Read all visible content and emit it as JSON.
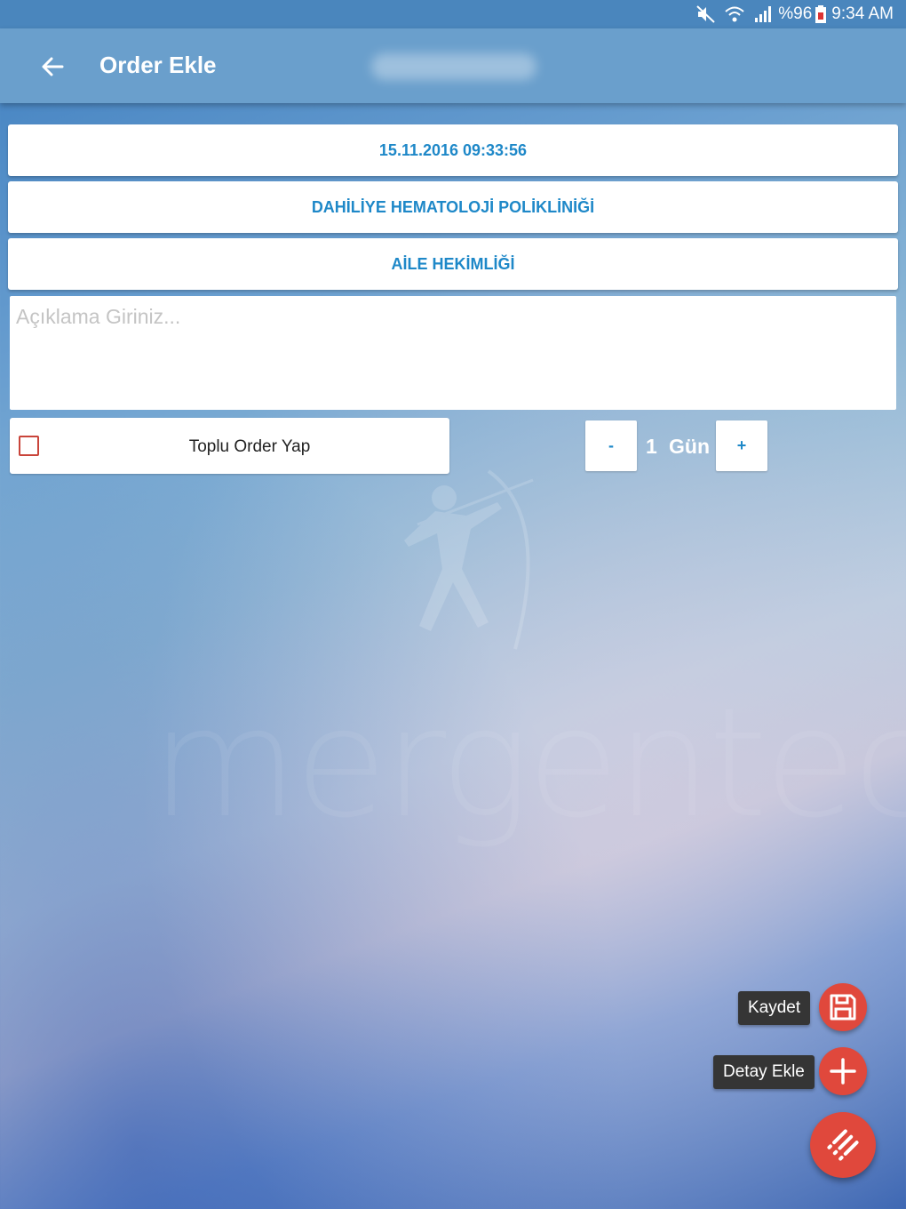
{
  "status_bar": {
    "battery_percent": "%96",
    "time": "9:34 AM",
    "icons": [
      "mute-icon",
      "wifi-icon",
      "signal-icon",
      "battery-icon"
    ]
  },
  "app_bar": {
    "title": "Order Ekle",
    "back_icon": "arrow-left-icon"
  },
  "form": {
    "datetime": "15.11.2016 09:33:56",
    "clinic": "DAHİLİYE HEMATOLOJİ POLİKLİNİĞİ",
    "department": "AİLE HEKİMLİĞİ",
    "note_placeholder": "Açıklama Giriniz...",
    "bulk_order_label": "Toplu Order Yap",
    "bulk_order_checked": false,
    "decrement_label": "-",
    "increment_label": "+",
    "day_count": "1",
    "day_unit": "Gün"
  },
  "fab_menu": {
    "save_label": "Kaydet",
    "add_detail_label": "Detay Ekle",
    "save_icon": "floppy-disk-icon",
    "add_icon": "plus-icon",
    "main_icon": "menu-list-icon"
  },
  "colors": {
    "accent": "#1e88c8",
    "fab": "#e0483c",
    "app_bar": "#6a9fcc",
    "status_bar": "#4a86bd"
  }
}
